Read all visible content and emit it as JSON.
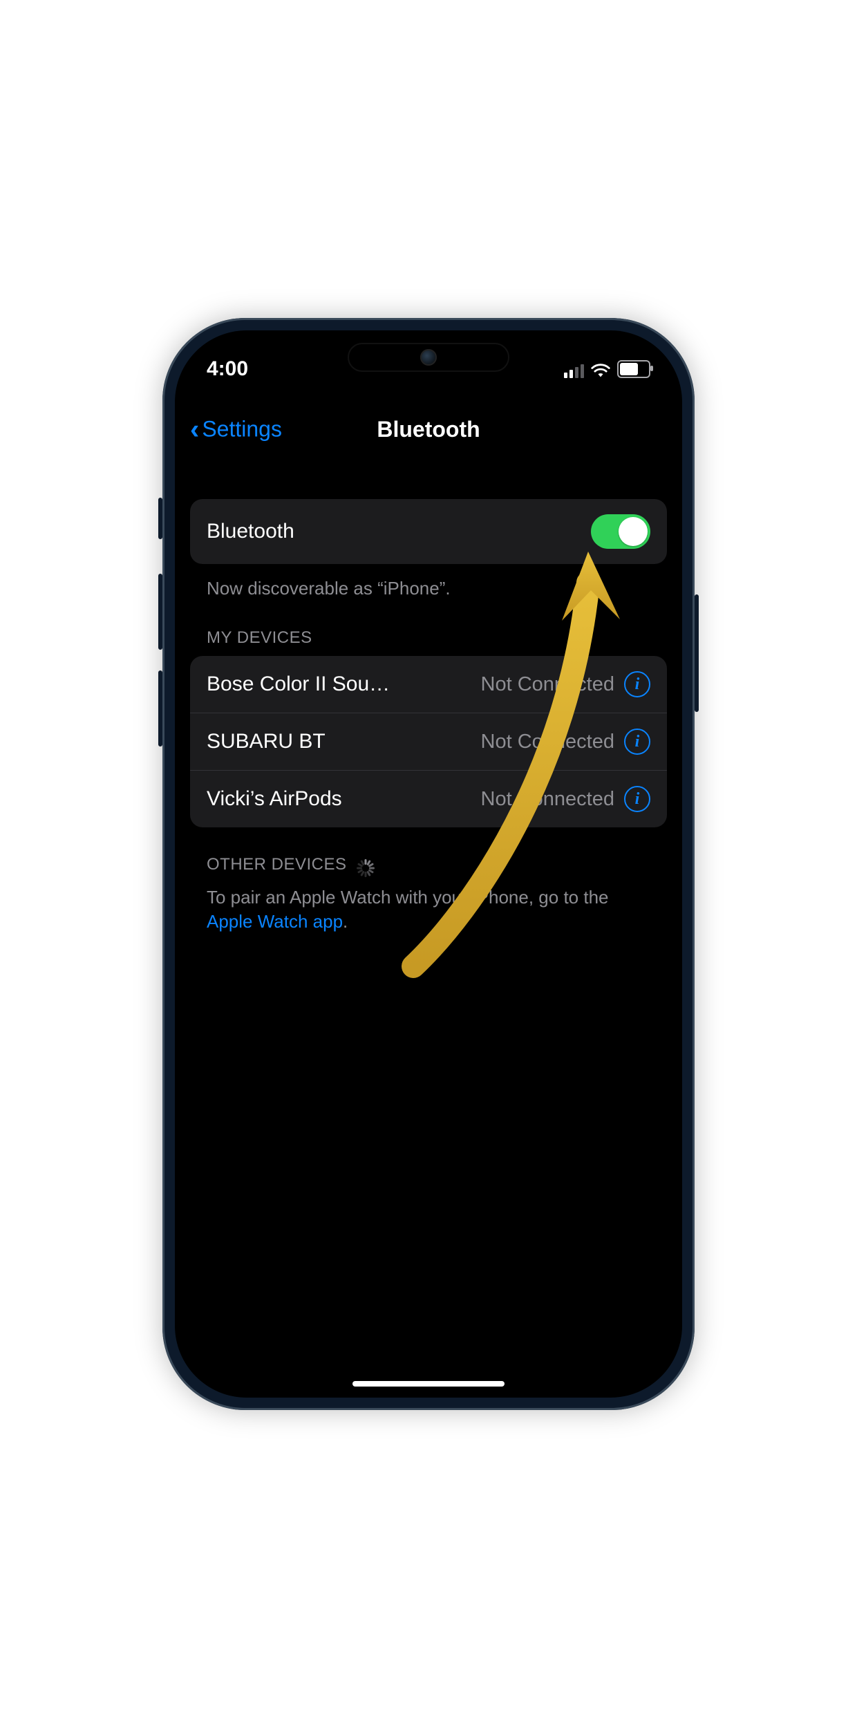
{
  "status_bar": {
    "time": "4:00"
  },
  "nav": {
    "back_label": "Settings",
    "title": "Bluetooth"
  },
  "bluetooth": {
    "toggle_label": "Bluetooth",
    "toggle_on": true,
    "discoverable_text": "Now discoverable as “iPhone”."
  },
  "my_devices": {
    "header": "MY DEVICES",
    "items": [
      {
        "name": "Bose Color II Sou…",
        "status": "Not Connected"
      },
      {
        "name": "SUBARU BT",
        "status": "Not Connected"
      },
      {
        "name": "Vicki’s AirPods",
        "status": "Not Connected"
      }
    ]
  },
  "other_devices": {
    "header": "OTHER DEVICES",
    "hint_prefix": "To pair an Apple Watch with your iPhone, go to the ",
    "hint_link": "Apple Watch app",
    "hint_suffix": "."
  },
  "colors": {
    "accent": "#0a84ff",
    "toggle_on": "#30d158",
    "cell_bg": "#1c1c1e",
    "secondary_text": "#8e8e93",
    "annotation": "#d6a92a"
  }
}
